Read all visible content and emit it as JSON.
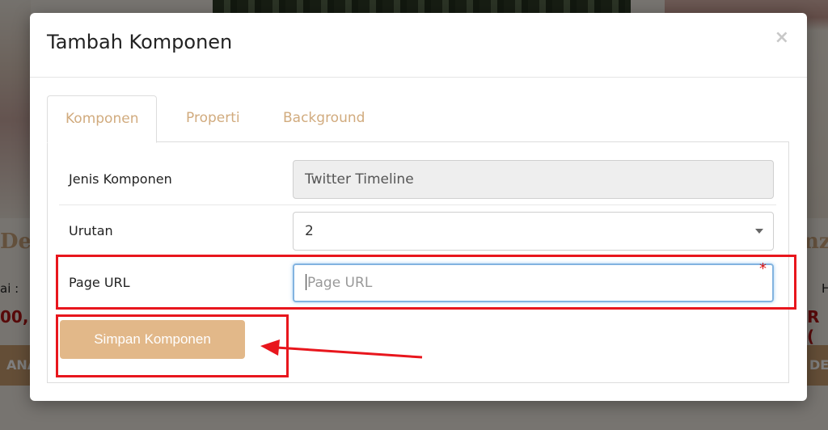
{
  "background": {
    "heading_left": "De",
    "heading_right": "nz",
    "label_left": "ai :",
    "label_right": "H",
    "price_left": "00,",
    "price_right": "R (",
    "button_left": "ANA",
    "button_right": "DET"
  },
  "modal": {
    "title": "Tambah Komponen",
    "close_symbol": "×",
    "tabs": [
      {
        "label": "Komponen",
        "active": true
      },
      {
        "label": "Properti",
        "active": false
      },
      {
        "label": "Background",
        "active": false
      }
    ],
    "fields": {
      "type": {
        "label": "Jenis Komponen",
        "value": "Twitter Timeline"
      },
      "order": {
        "label": "Urutan",
        "value": "2"
      },
      "page_url": {
        "label": "Page URL",
        "placeholder": "Page URL",
        "required_mark": "*"
      }
    },
    "save_label": "Simpan Komponen"
  },
  "colors": {
    "accent": "#e2b889",
    "tab_text": "#d1ab7e",
    "annotation": "#e8161d"
  }
}
